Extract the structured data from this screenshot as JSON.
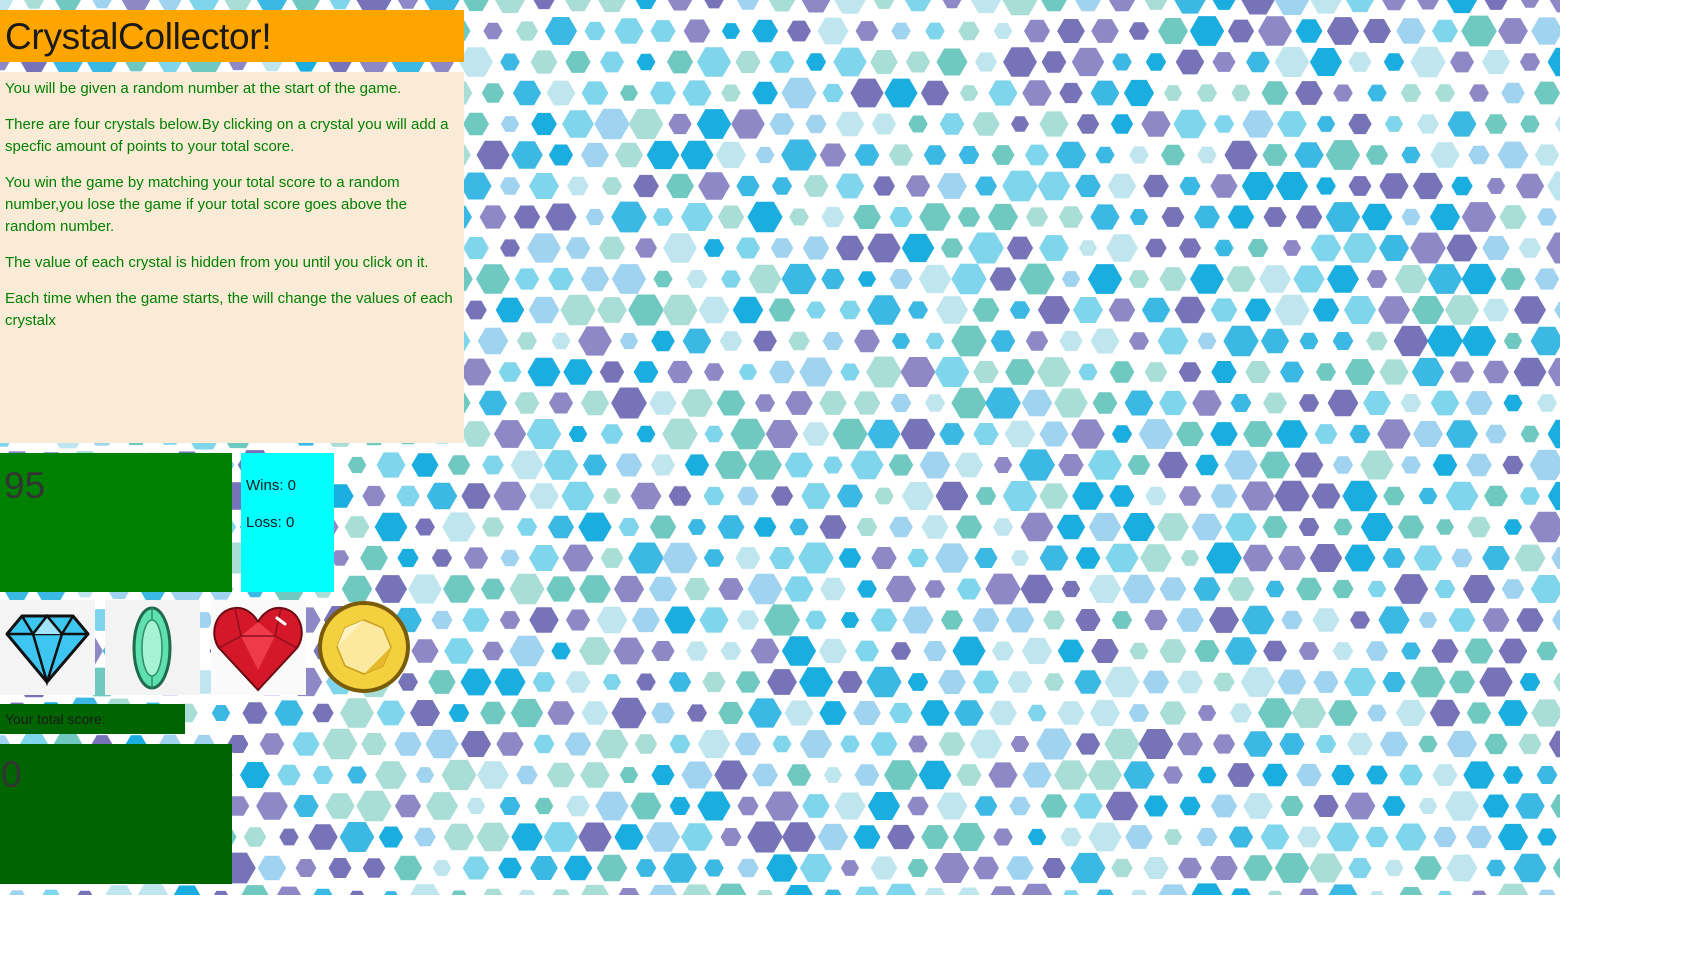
{
  "game": {
    "title": "CrystalCollector!",
    "instructions": [
      "You will be given a random number at the start of the game.",
      "There are four crystals below.By clicking on a crystal you will add a specfic amount of points to your total score.",
      "You win the game by matching your total score to a random number,you lose the game if your total score goes above the random number.",
      "The value of each crystal is hidden from you until you click on it.",
      "Each time when the game starts, the will change the values of each crystalx"
    ],
    "random_number": "95",
    "wins": "Wins: 0",
    "losses": "Loss: 0",
    "score_label": "Your total score:",
    "total_score": "0"
  },
  "crystals": [
    {
      "icon": "blue-diamond-icon",
      "color": "#3ec6f2"
    },
    {
      "icon": "green-emerald-icon",
      "color": "#5ee0b0"
    },
    {
      "icon": "red-heart-gem-icon",
      "color": "#d4182a"
    },
    {
      "icon": "yellow-topaz-icon",
      "color": "#f4d03f"
    }
  ],
  "colors": {
    "header": "#ffa500",
    "panel": "#faebd7",
    "text_green": "#008000",
    "target_box": "#008000",
    "stats_box": "#00ffff",
    "score_box": "#006400"
  }
}
